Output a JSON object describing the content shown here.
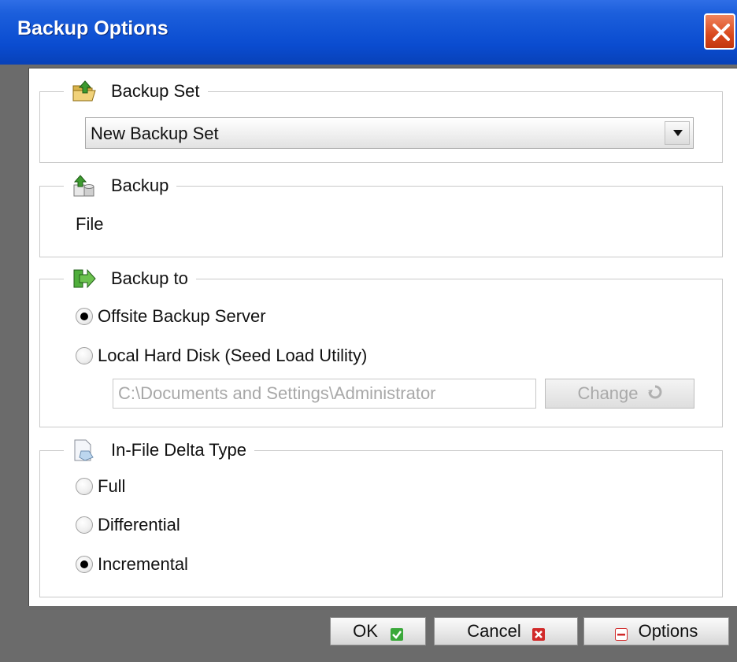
{
  "window": {
    "title": "Backup Options",
    "close_icon": "close-icon"
  },
  "backup_set": {
    "legend": "Backup Set",
    "icon": "folder-upload-icon",
    "selected": "New Backup Set"
  },
  "backup": {
    "legend": "Backup",
    "icon": "backup-source-icon",
    "value": "File"
  },
  "backup_to": {
    "legend": "Backup to",
    "icon": "green-arrow-icon",
    "options": [
      {
        "label": "Offsite Backup Server",
        "checked": true
      },
      {
        "label": "Local Hard Disk (Seed Load Utility)",
        "checked": false
      }
    ],
    "path_value": "C:\\Documents and Settings\\Administrator",
    "change_label": "Change"
  },
  "delta": {
    "legend": "In-File Delta Type",
    "icon": "delta-document-icon",
    "options": [
      {
        "label": "Full",
        "checked": false
      },
      {
        "label": "Differential",
        "checked": false
      },
      {
        "label": "Incremental",
        "checked": true
      }
    ]
  },
  "footer": {
    "ok_label": "OK",
    "cancel_label": "Cancel",
    "options_label": "Options"
  },
  "colors": {
    "titlebar": "#0a4cd0",
    "close": "#d9491d",
    "ok_check": "#3aa83a",
    "cancel_x": "#d12a2a",
    "options_minus": "#d12a2a"
  }
}
